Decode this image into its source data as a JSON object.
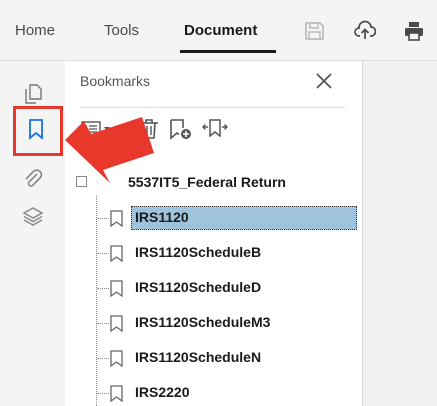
{
  "menu": {
    "tabs": [
      {
        "label": "Home",
        "active": false
      },
      {
        "label": "Tools",
        "active": false
      },
      {
        "label": "Document",
        "active": true
      }
    ],
    "toolbar_icons": [
      "save-icon",
      "cloud-upload-icon",
      "print-icon"
    ]
  },
  "rail": {
    "icons": [
      "page-thumbnails-icon",
      "bookmark-icon",
      "attachment-icon",
      "layers-icon"
    ],
    "highlight_color": "#e8372b"
  },
  "panel": {
    "title": "Bookmarks",
    "tools": [
      "options-menu-icon",
      "delete-bookmark-icon",
      "new-bookmark-icon",
      "expand-bookmark-icon"
    ]
  },
  "bookmarks": {
    "root": "5537IT5_Federal Return",
    "items": [
      {
        "label": "IRS1120",
        "selected": true
      },
      {
        "label": "IRS1120ScheduleB",
        "selected": false
      },
      {
        "label": "IRS1120ScheduleD",
        "selected": false
      },
      {
        "label": "IRS1120ScheduleM3",
        "selected": false
      },
      {
        "label": "IRS1120ScheduleN",
        "selected": false
      },
      {
        "label": "IRS2220",
        "selected": false
      }
    ]
  },
  "colors": {
    "selection": "#9fc3dc",
    "accent_blue": "#1473e6",
    "callout_red": "#e8372b"
  }
}
